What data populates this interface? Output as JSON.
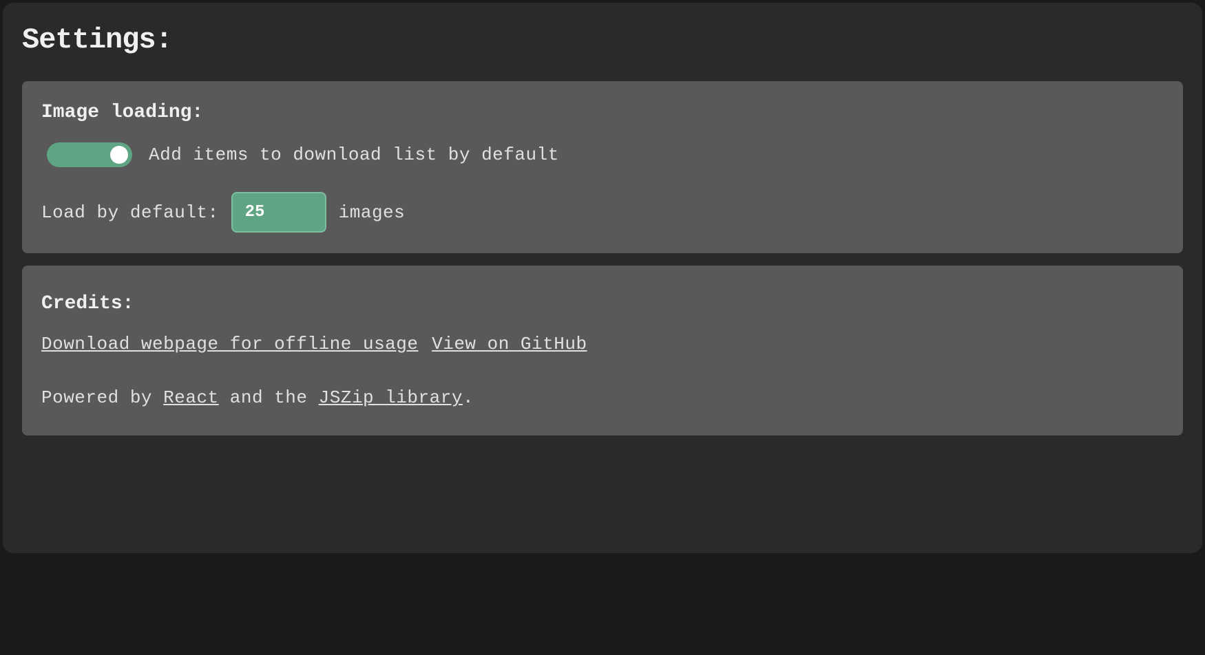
{
  "page": {
    "title": "Settings:"
  },
  "imageLoading": {
    "heading": "Image loading:",
    "toggleLabel": "Add items to download list by default",
    "toggleOn": true,
    "loadPrefix": "Load by default:",
    "loadValue": "25",
    "loadSuffix": "images"
  },
  "credits": {
    "heading": "Credits:",
    "downloadLink": "Download webpage for offline usage",
    "githubLink": "View on GitHub",
    "poweredPrefix": "Powered by ",
    "reactLink": "React",
    "middle": " and the ",
    "jszipLink": "JSZip library",
    "suffix": "."
  }
}
